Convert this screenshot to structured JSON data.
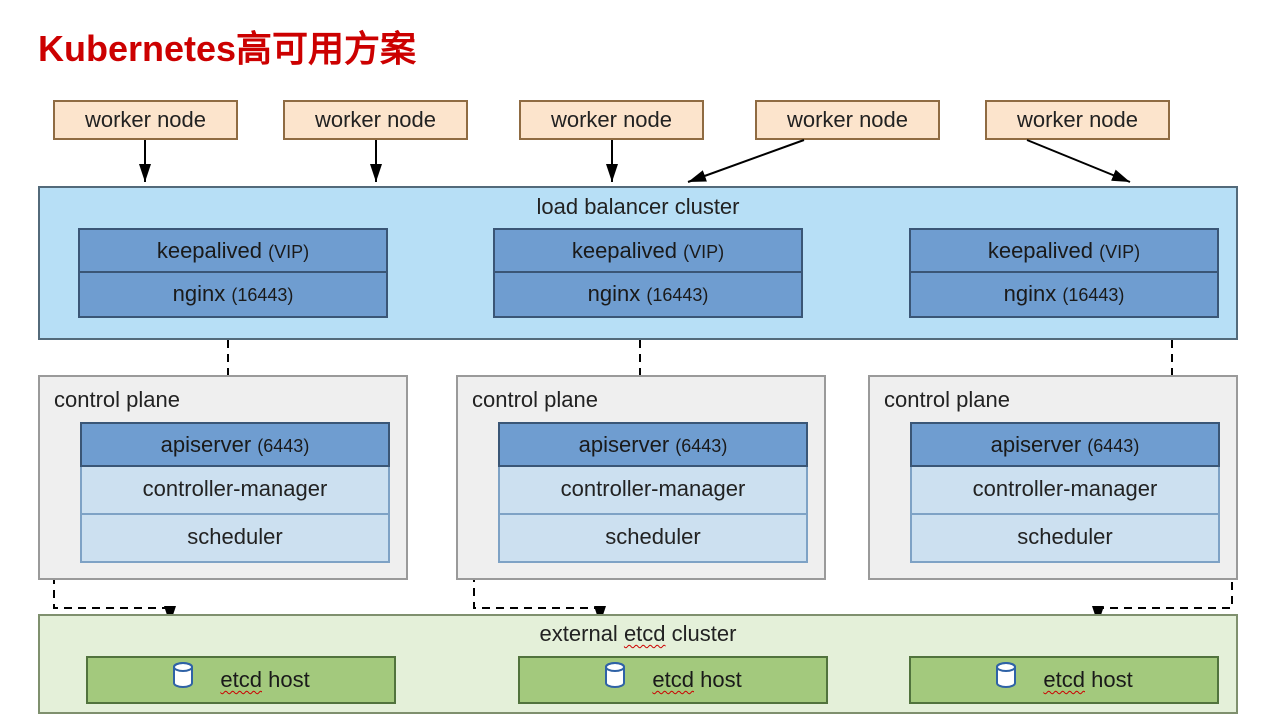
{
  "title": "Kubernetes高可用方案",
  "worker_label": "worker node",
  "lb": {
    "title": "load balancer cluster",
    "keepalived": "keepalived",
    "keepalived_port": "(VIP)",
    "nginx": "nginx",
    "nginx_port": "(16443)"
  },
  "cp": {
    "title": "control plane",
    "apiserver": "apiserver",
    "apiserver_port": "(6443)",
    "cm": "controller-manager",
    "scheduler": "scheduler"
  },
  "etcd": {
    "title": "external etcd cluster",
    "host": "etcd host",
    "etcd_word": "etcd",
    "host_word": " host"
  }
}
